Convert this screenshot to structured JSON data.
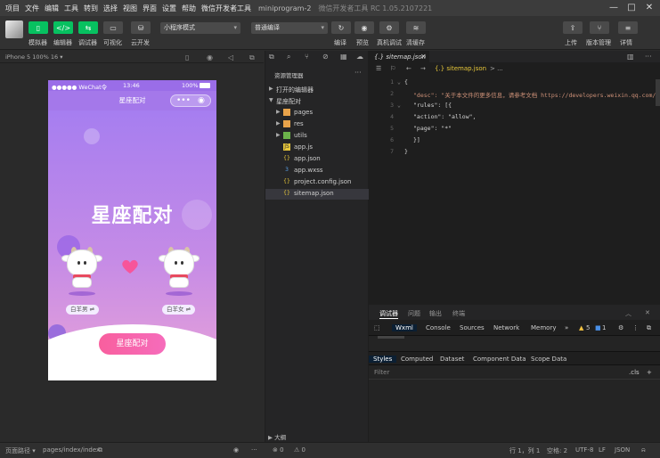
{
  "menubar": {
    "items": [
      "项目",
      "文件",
      "编辑",
      "工具",
      "转到",
      "选择",
      "视图",
      "界面",
      "设置",
      "帮助",
      "微信开发者工具"
    ],
    "title": "miniprogram-2",
    "version": "微信开发者工具 RC 1.05.2107221"
  },
  "toolbar": {
    "simulator_label": "模拟器",
    "editor_label": "编辑器",
    "debugger_label": "调试器",
    "visual_label": "可视化",
    "cloud_label": "云开发",
    "mode_select": "小程序模式",
    "compile_select": "普通编译",
    "compile_label": "编译",
    "preview_label": "预览",
    "realdevice_label": "真机调试",
    "clearcache_label": "清缓存",
    "upload_label": "上传",
    "version_label": "版本管理",
    "detail_label": "详情"
  },
  "simulator": {
    "device": "iPhone 5 100% 16 ▾",
    "status_carrier": "●●●●● WeChat令",
    "status_time": "13:46",
    "status_battery": "100%",
    "nav_title": "星座配对",
    "page_title": "星座配对",
    "left_sign": "白羊男 ⇌",
    "right_sign": "白羊女 ⇌",
    "match_button": "星座配对"
  },
  "explorer": {
    "title": "资源管理器",
    "open_editors": "打开的编辑器",
    "project": "星座配对",
    "items": [
      {
        "name": "pages",
        "type": "folder"
      },
      {
        "name": "res",
        "type": "folder"
      },
      {
        "name": "utils",
        "type": "folder"
      },
      {
        "name": "app.js",
        "type": "js"
      },
      {
        "name": "app.json",
        "type": "json"
      },
      {
        "name": "app.wxss",
        "type": "wxss"
      },
      {
        "name": "project.config.json",
        "type": "json"
      },
      {
        "name": "sitemap.json",
        "type": "json"
      }
    ],
    "outline": "大纲"
  },
  "editor": {
    "tab": "{.} sitemap.json",
    "breadcrumb_file": "{.} sitemap.json",
    "breadcrumb_more": "> ...",
    "lines": [
      {
        "n": "1",
        "t": "{"
      },
      {
        "n": "2",
        "t": "\"desc\": \"关于本文件的更多信息，请参考文档 https://developers.weixin.qq.com/"
      },
      {
        "n": "3",
        "t": "\"rules\": [{"
      },
      {
        "n": "4",
        "t": "\"action\": \"allow\","
      },
      {
        "n": "5",
        "t": "\"page\": \"*\""
      },
      {
        "n": "6",
        "t": "}]"
      },
      {
        "n": "7",
        "t": "}"
      }
    ]
  },
  "debug": {
    "tabs": [
      "调试器",
      "问题",
      "输出",
      "终端"
    ],
    "devtools_tabs": [
      "Wxml",
      "Console",
      "Sources",
      "Network",
      "Memory"
    ],
    "warn_count": "5",
    "info_count": "1",
    "style_tabs": [
      "Styles",
      "Computed",
      "Dataset",
      "Component Data",
      "Scope Data"
    ],
    "filter_placeholder": "Filter",
    "cls": ".cls"
  },
  "footer": {
    "page_path_label": "页面路径 ▾",
    "page_path": "pages/index/index",
    "errors": "⊗ 0",
    "warnings": "⚠ 0",
    "position": "行 1，列 1",
    "spaces": "空格: 2",
    "encoding": "UTF-8",
    "eol": "LF",
    "lang": "JSON"
  },
  "colors": {
    "accent_green": "#07c160",
    "phone_purple": "#a478ea",
    "match_pink": "#f85f9e"
  }
}
